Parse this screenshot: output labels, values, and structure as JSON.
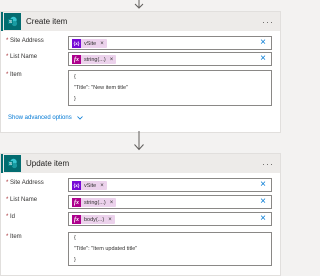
{
  "create_item": {
    "title": "Create item",
    "more": "···",
    "site_address": {
      "label": "Site Address",
      "token": "vSite",
      "token_x": "×"
    },
    "list_name": {
      "label": "List Name",
      "token": "string(...)",
      "token_x": "×"
    },
    "item": {
      "label": "Item",
      "lines": [
        "{",
        "\"Title\": \"New item title\"",
        "}"
      ]
    },
    "advanced": "Show advanced options",
    "clear": "×"
  },
  "update_item": {
    "title": "Update item",
    "more": "···",
    "site_address": {
      "label": "Site Address",
      "token": "vSite",
      "token_x": "×"
    },
    "list_name": {
      "label": "List Name",
      "token": "string(...)",
      "token_x": "×"
    },
    "id": {
      "label": "Id",
      "token": "body(...)",
      "token_x": "×"
    },
    "item": {
      "label": "Item",
      "lines": [
        "{",
        "\"Title\": \"Item updated title\"",
        "}"
      ]
    },
    "clear": "×"
  },
  "required_mark": "*",
  "var_icon": "{x}",
  "fx_icon": "fx",
  "colors": {
    "sharepoint": "#036c70",
    "variable": "#770bd6",
    "expression": "#ad008c",
    "token_bg": "#ecd2ec",
    "link": "#0078d4"
  }
}
